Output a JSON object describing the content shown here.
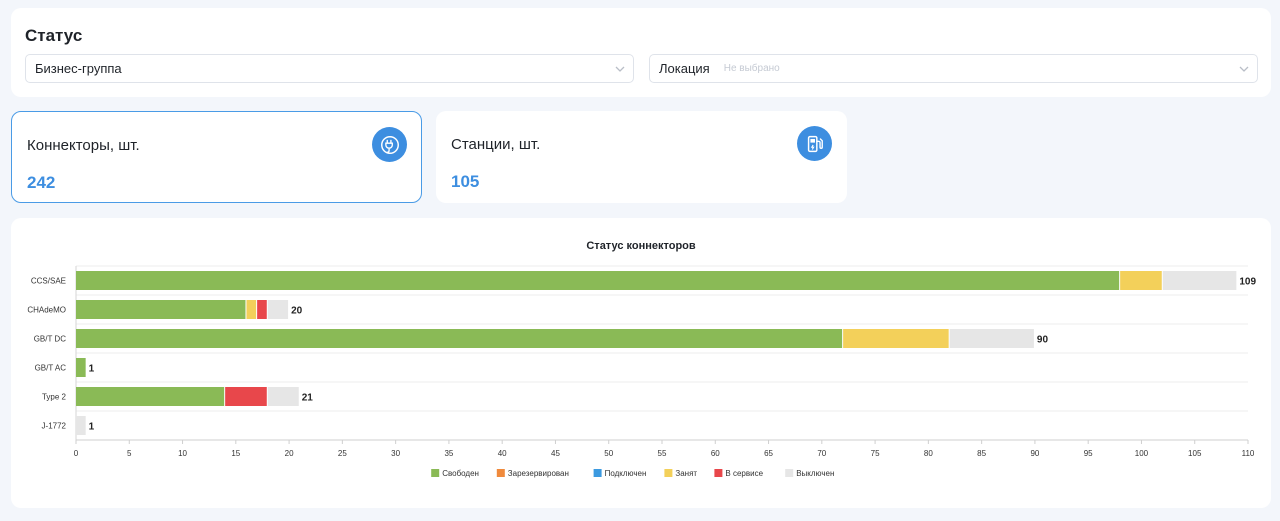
{
  "status": {
    "title": "Статус",
    "business_group": {
      "label": "Бизнес-группа"
    },
    "location": {
      "label": "Локация",
      "placeholder": "Не выбрано"
    }
  },
  "kpis": {
    "connectors": {
      "title": "Коннекторы, шт.",
      "value": "242",
      "icon": "plug-icon"
    },
    "stations": {
      "title": "Станции, шт.",
      "value": "105",
      "icon": "charging-station-icon"
    }
  },
  "colors": {
    "accent": "#3d8ee0",
    "free": "#8aba56",
    "reserved": "#f08a3c",
    "connected": "#3c9ae0",
    "busy": "#f3d05a",
    "service": "#e8474b",
    "off": "#e6e6e6"
  },
  "chart_data": {
    "type": "bar",
    "orientation": "horizontal",
    "stacked": true,
    "title": "Статус коннекторов",
    "categories": [
      "CCS/SAE",
      "CHAdeMO",
      "GB/T DC",
      "GB/T AC",
      "Type 2",
      "J-1772"
    ],
    "series": [
      {
        "name": "Свободен",
        "color": "#8aba56",
        "values": [
          98,
          16,
          72,
          1,
          14,
          0
        ]
      },
      {
        "name": "Зарезервирован",
        "color": "#f08a3c",
        "values": [
          0,
          0,
          0,
          0,
          0,
          0
        ]
      },
      {
        "name": "Подключен",
        "color": "#3c9ae0",
        "values": [
          0,
          0,
          0,
          0,
          0,
          0
        ]
      },
      {
        "name": "Занят",
        "color": "#f3d05a",
        "values": [
          4,
          1,
          10,
          0,
          0,
          0
        ]
      },
      {
        "name": "В сервисе",
        "color": "#e8474b",
        "values": [
          0,
          1,
          0,
          0,
          4,
          0
        ]
      },
      {
        "name": "Выключен",
        "color": "#e6e6e6",
        "values": [
          7,
          2,
          8,
          0,
          3,
          1
        ]
      }
    ],
    "totals": [
      109,
      20,
      90,
      1,
      21,
      1
    ],
    "xlim": [
      0,
      110
    ],
    "xticks": [
      0,
      5,
      10,
      15,
      20,
      25,
      30,
      35,
      40,
      45,
      50,
      55,
      60,
      65,
      70,
      75,
      80,
      85,
      90,
      95,
      100,
      105,
      110
    ],
    "legend_position": "bottom",
    "grid": "horizontal separators"
  }
}
